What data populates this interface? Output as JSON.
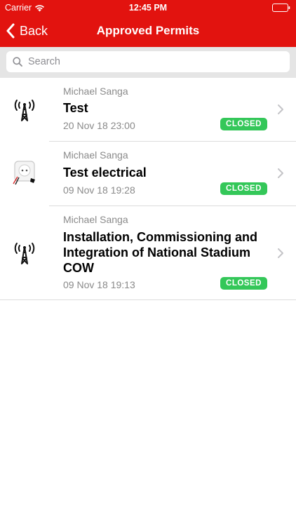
{
  "status_bar": {
    "carrier": "Carrier",
    "time": "12:45 PM",
    "battery_color": "#e2130f"
  },
  "nav": {
    "back_label": "Back",
    "title": "Approved Permits",
    "bar_color": "#e2130f"
  },
  "search": {
    "placeholder": "Search",
    "value": ""
  },
  "permits": [
    {
      "author": "Michael Sanga",
      "title": "Test",
      "date": "20 Nov 18 23:00",
      "status": "CLOSED",
      "icon": "cell-tower-icon"
    },
    {
      "author": "Michael Sanga",
      "title": "Test electrical",
      "date": "09 Nov 18 19:28",
      "status": "CLOSED",
      "icon": "electrical-socket-icon"
    },
    {
      "author": "Michael Sanga",
      "title": "Installation, Commissioning and Integration of National Stadium COW",
      "date": "09 Nov 18 19:13",
      "status": "CLOSED",
      "icon": "cell-tower-icon"
    }
  ],
  "colors": {
    "badge_closed": "#34c759",
    "secondary_text": "#8a8a8a"
  }
}
